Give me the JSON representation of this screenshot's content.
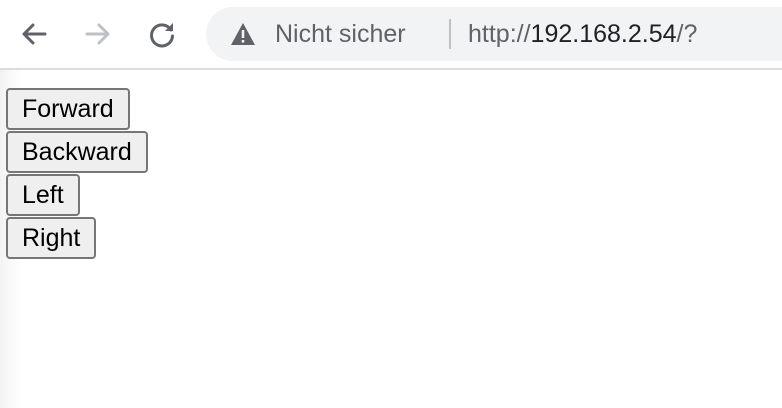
{
  "browser": {
    "security_label": "Nicht sicher",
    "url_scheme": "http://",
    "url_host": "192.168.2.54",
    "url_rest": "/?",
    "icons": {
      "back": "back-arrow-icon",
      "forward": "forward-arrow-icon",
      "reload": "reload-icon",
      "warning": "warning-icon"
    }
  },
  "controls": {
    "forward_label": "Forward",
    "backward_label": "Backward",
    "left_label": "Left",
    "right_label": "Right"
  }
}
